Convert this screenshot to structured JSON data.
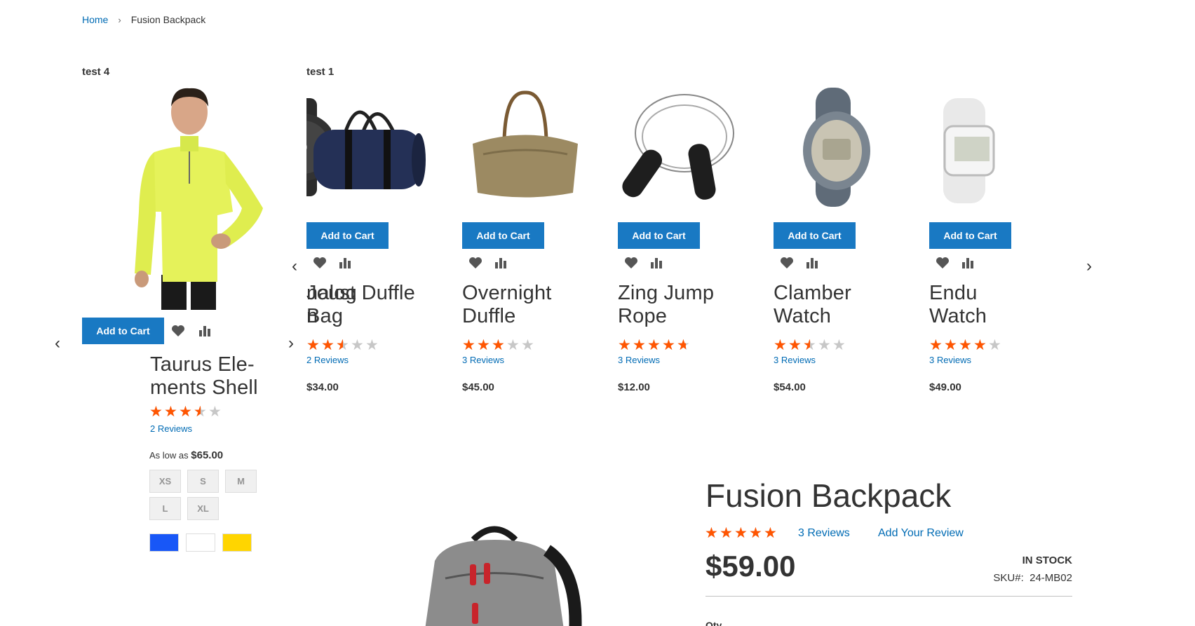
{
  "breadcrumb": {
    "home": "Home",
    "current": "Fusion Backpack"
  },
  "block_left": {
    "title": "test 4",
    "product": {
      "name": "Taurus Ele- ments Shell",
      "name_line1": "Taurus Ele-",
      "name_line2": "ments Shell",
      "rating_percent": 70,
      "reviews": "2  Reviews",
      "price_label": "As low as",
      "price": "$65.00",
      "add_to_cart": "Add to Cart",
      "sizes": [
        "XS",
        "S",
        "M",
        "L",
        "XL"
      ],
      "colors": [
        "#1857f7",
        "#ffffff",
        "#ffd500"
      ]
    }
  },
  "block_right": {
    "title": "test 1",
    "partial_prev": {
      "name_fragment_1": "nalog",
      "name_fragment_2": "n",
      "button_fragment": "art"
    },
    "products": [
      {
        "name": "Joust Duffle Bag",
        "line1": "Joust Duffle",
        "line2": "Bag",
        "rating_percent": 50,
        "reviews": "2  Reviews",
        "price": "$34.00",
        "add_to_cart": "Add to Cart",
        "image": "duffle-bag-navy"
      },
      {
        "name": "Overnight Duffle",
        "line1": "Overnight",
        "line2": "Duffle",
        "rating_percent": 60,
        "reviews": "3  Reviews",
        "price": "$45.00",
        "add_to_cart": "Add to Cart",
        "image": "duffle-bag-tan"
      },
      {
        "name": "Zing Jump Rope",
        "line1": "Zing Jump",
        "line2": "Rope",
        "rating_percent": 93,
        "reviews": "3  Reviews",
        "price": "$12.00",
        "add_to_cart": "Add to Cart",
        "image": "jump-rope"
      },
      {
        "name": "Clamber Watch",
        "line1": "Clamber",
        "line2": "Watch",
        "rating_percent": 50,
        "reviews": "3  Reviews",
        "price": "$54.00",
        "add_to_cart": "Add to Cart",
        "image": "watch-grey"
      },
      {
        "name": "Endu Watch",
        "line1": "Endu",
        "line2": "Watch",
        "rating_percent": 80,
        "reviews": "3  Reviews",
        "price": "$49.00",
        "add_to_cart": "Add to Cart",
        "image": "watch-white"
      }
    ]
  },
  "main_product": {
    "title": "Fusion Backpack",
    "rating_percent": 100,
    "reviews": "3  Reviews",
    "add_review": "Add Your Review",
    "price": "$59.00",
    "stock": "IN STOCK",
    "sku_label": "SKU#:",
    "sku": "24-MB02",
    "qty_label": "Qty"
  },
  "colors": {
    "accent": "#1979c3",
    "star": "#ff5501",
    "link": "#006bb4"
  }
}
